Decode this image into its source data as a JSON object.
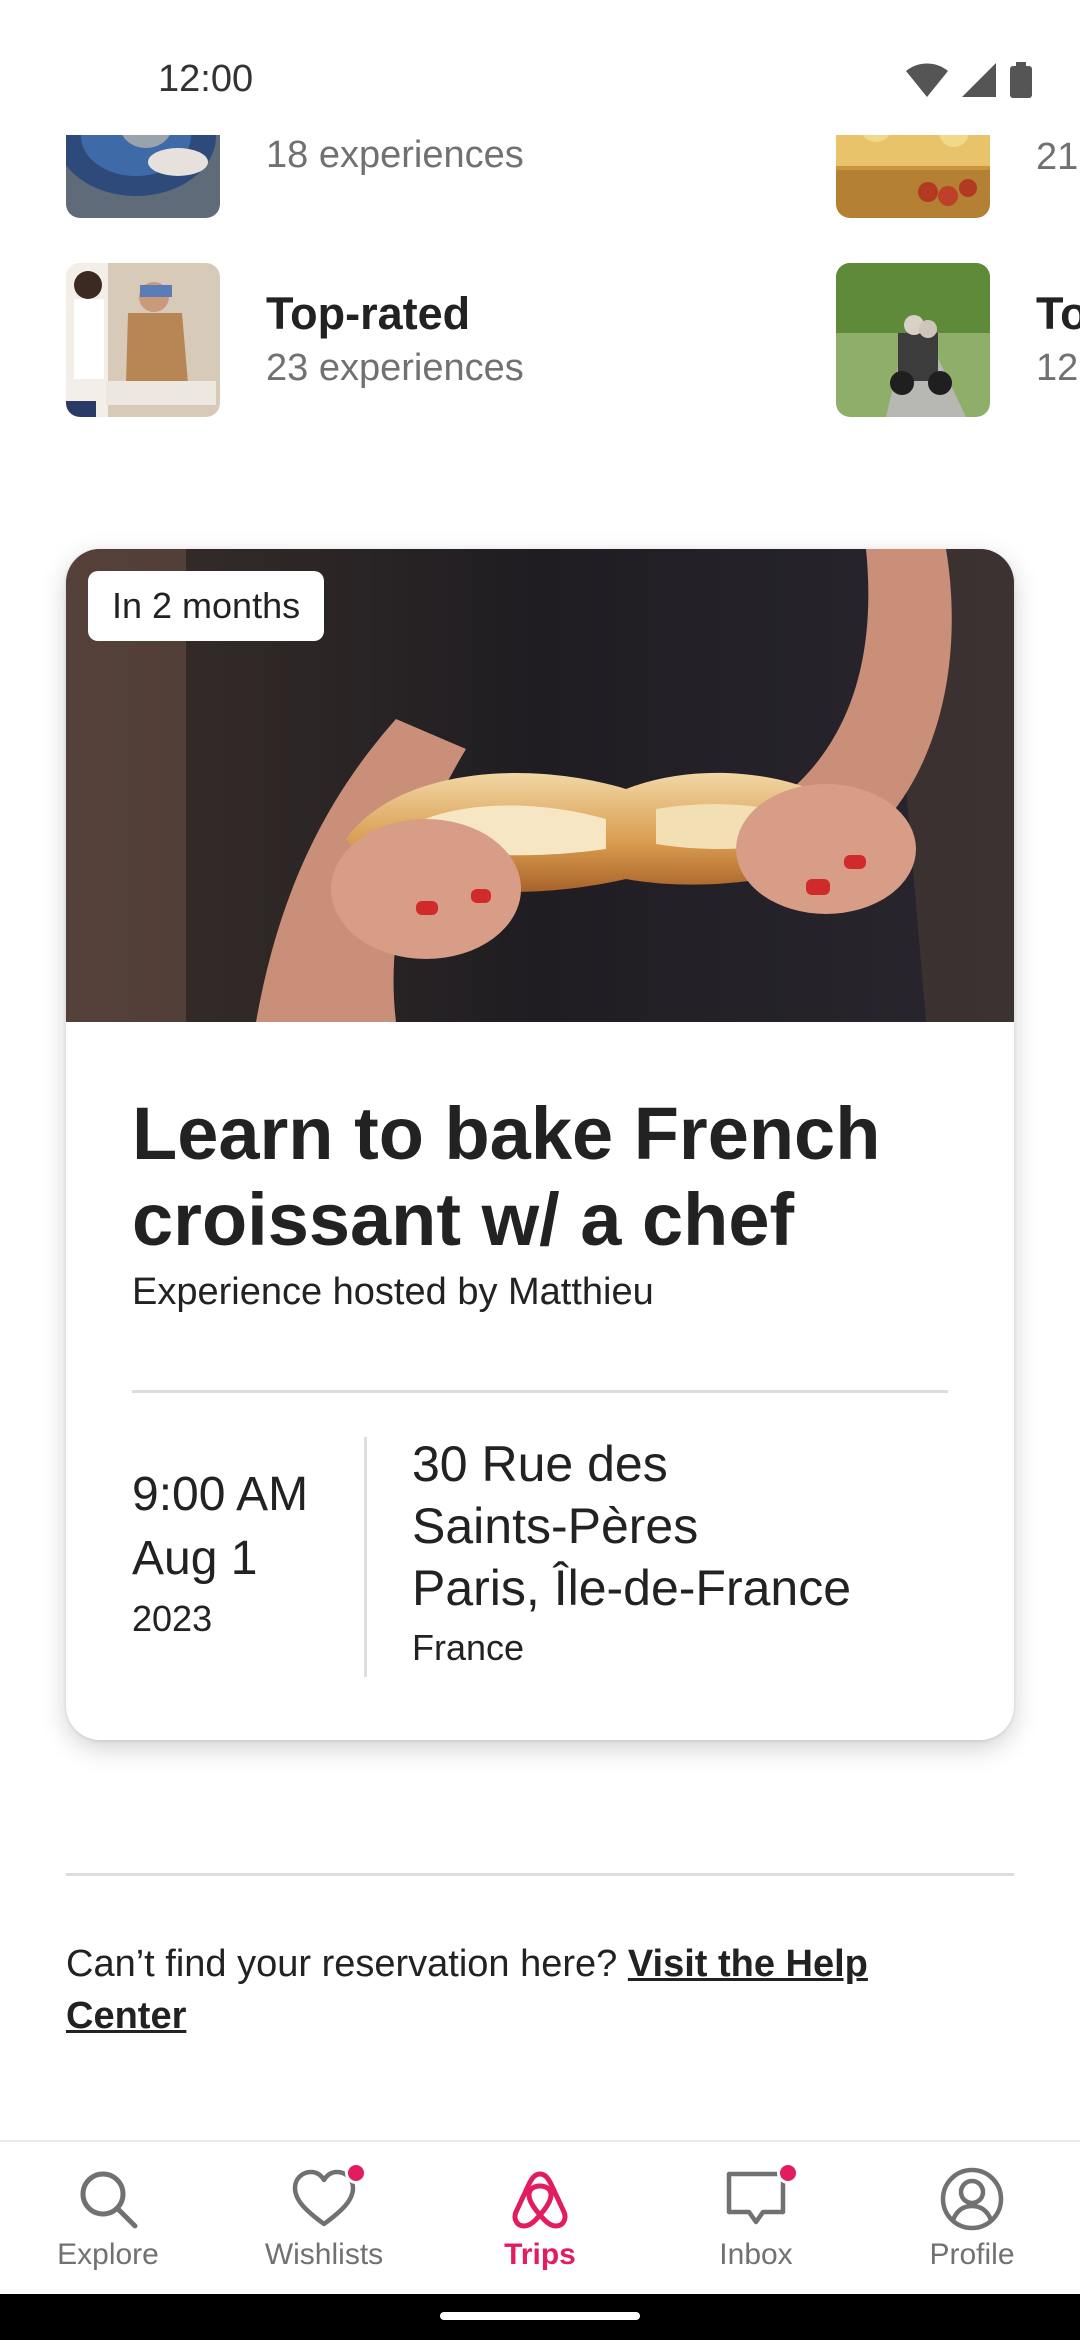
{
  "status_bar": {
    "time": "12:00"
  },
  "categories": [
    {
      "title": "",
      "count": "18 experiences",
      "image": "pottery-image"
    },
    {
      "title": "",
      "count": "21",
      "image": "pasta-image"
    },
    {
      "title": "Top-rated",
      "count": "23 experiences",
      "image": "baking-class-image"
    },
    {
      "title": "To",
      "count": "12",
      "image": "sidecar-tour-image"
    }
  ],
  "reservation": {
    "badge": "In 2 months",
    "title": "Learn to bake French croissant w/ a chef",
    "host": "Experience hosted by Matthieu",
    "time": "9:00 AM",
    "date": "Aug 1",
    "year": "2023",
    "address_line1": "30 Rue des",
    "address_line2": "Saints-Pères",
    "address_line3": "Paris, Île-de-France",
    "country": "France"
  },
  "help": {
    "text": "Can’t find your reservation here?",
    "link": "Visit the Help Center"
  },
  "nav": {
    "items": [
      {
        "label": "Explore",
        "icon": "search-icon",
        "badge": false,
        "active": false
      },
      {
        "label": "Wishlists",
        "icon": "heart-icon",
        "badge": true,
        "active": false
      },
      {
        "label": "Trips",
        "icon": "airbnb-logo-icon",
        "badge": false,
        "active": true
      },
      {
        "label": "Inbox",
        "icon": "message-icon",
        "badge": true,
        "active": false
      },
      {
        "label": "Profile",
        "icon": "profile-icon",
        "badge": false,
        "active": false
      }
    ]
  },
  "colors": {
    "accent": "#e31c5f",
    "text": "#222222",
    "muted": "#717171",
    "divider": "#dddddd"
  }
}
